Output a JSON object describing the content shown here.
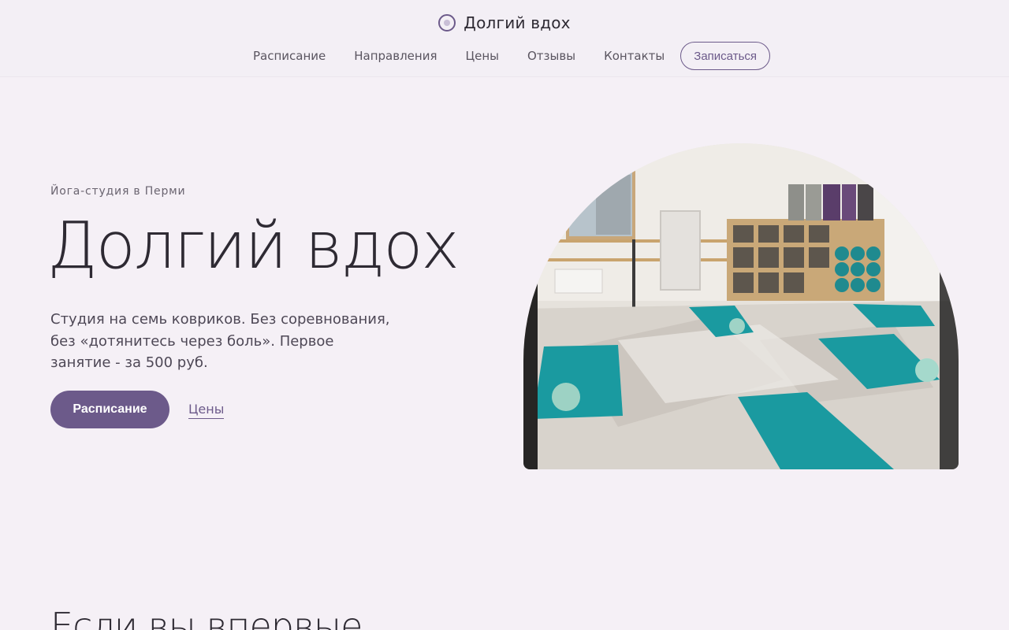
{
  "header": {
    "brand_name": "Долгий вдох",
    "nav": [
      "Расписание",
      "Направления",
      "Цены",
      "Отзывы",
      "Контакты"
    ],
    "cta_label": "Записаться"
  },
  "hero": {
    "eyebrow": "Йога-студия в Перми",
    "title": "Долгий вдох",
    "text": "Студия на семь ковриков. Без соревнования, без «дотянитесь через боль». Первое занятие - за 500 руб.",
    "primary_button": "Расписание",
    "secondary_link": "Цены"
  },
  "next_section": {
    "title": "Если вы впервые"
  },
  "colors": {
    "background": "#f5f0f6",
    "accent": "#6c5a8a",
    "text": "#2e2a33",
    "mat": "#1a9aa0"
  }
}
